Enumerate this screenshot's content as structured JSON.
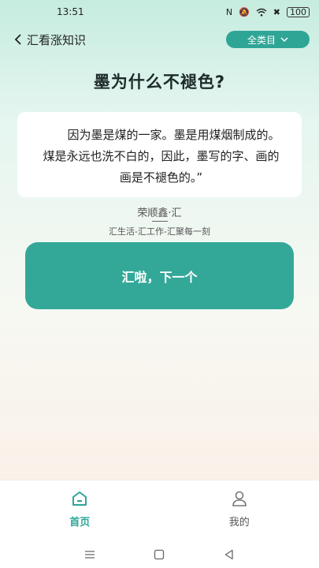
{
  "status": {
    "time": "13:51",
    "battery": "100"
  },
  "nav": {
    "back_label": "汇看涨知识",
    "category_label": "全类目"
  },
  "question": {
    "title": "墨为什么不褪色?"
  },
  "answer": {
    "text": "因为墨是煤的一家。墨是用煤烟制成的。煤是永远也洗不白的，因此，墨写的字、画的画是不褪色的。”"
  },
  "source": {
    "name": "荣顺鑫·汇",
    "tagline": "汇生活-汇工作-汇聚每一刻"
  },
  "next_button": {
    "label": "汇啦，下一个"
  },
  "tabbar": {
    "home_label": "首页",
    "mine_label": "我的"
  },
  "colors": {
    "accent": "#2fa596",
    "button": "#34a898"
  }
}
